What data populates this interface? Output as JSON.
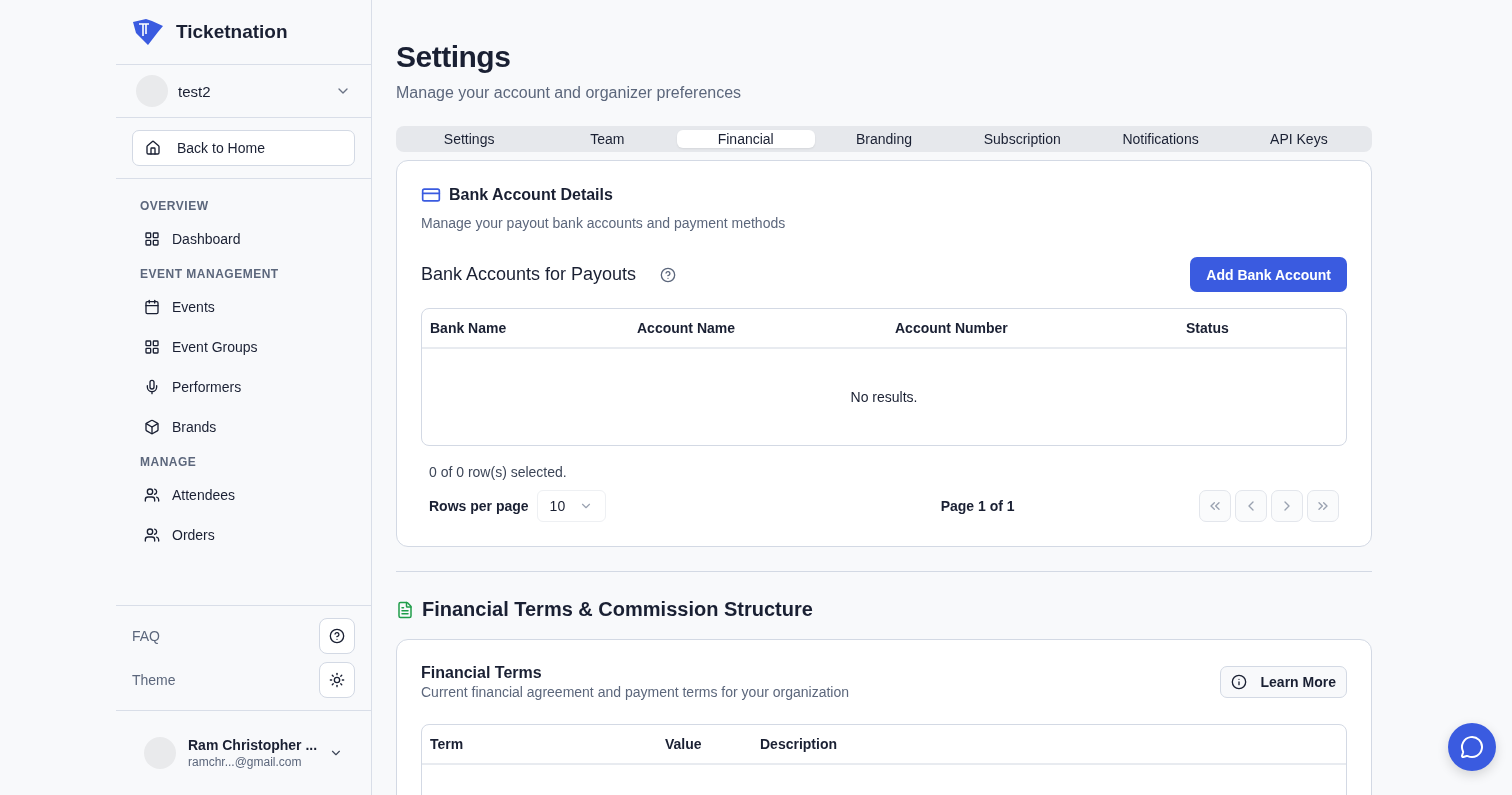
{
  "brand": {
    "name": "Ticketnation"
  },
  "org_switcher": {
    "name": "test2"
  },
  "back_button": "Back to Home",
  "nav_sections": [
    {
      "title": "OVERVIEW",
      "items": [
        {
          "label": "Dashboard"
        }
      ]
    },
    {
      "title": "EVENT MANAGEMENT",
      "items": [
        {
          "label": "Events"
        },
        {
          "label": "Event Groups"
        },
        {
          "label": "Performers"
        },
        {
          "label": "Brands"
        }
      ]
    },
    {
      "title": "MANAGE",
      "items": [
        {
          "label": "Attendees"
        },
        {
          "label": "Orders"
        }
      ]
    }
  ],
  "footer_links": [
    {
      "label": "FAQ"
    },
    {
      "label": "Theme"
    }
  ],
  "user": {
    "name": "Ram Christopher ...",
    "email": "ramchr...@gmail.com"
  },
  "page": {
    "title": "Settings",
    "subtitle": "Manage your account and organizer preferences"
  },
  "tabs": [
    {
      "label": "Settings",
      "selected": false
    },
    {
      "label": "Team",
      "selected": false
    },
    {
      "label": "Financial",
      "selected": true
    },
    {
      "label": "Branding",
      "selected": false
    },
    {
      "label": "Subscription",
      "selected": false
    },
    {
      "label": "Notifications",
      "selected": false
    },
    {
      "label": "API Keys",
      "selected": false
    }
  ],
  "bank_card": {
    "title": "Bank Account Details",
    "description": "Manage your payout bank accounts and payment methods",
    "section_title": "Bank Accounts for Payouts",
    "add_button": "Add Bank Account",
    "table": {
      "columns": [
        "Bank Name",
        "Account Name",
        "Account Number",
        "Status"
      ],
      "empty_text": "No results."
    },
    "selection_text": "0 of 0 row(s) selected.",
    "rows_per_page_label": "Rows per page",
    "rows_per_page": "10",
    "page_text": "Page 1 of 1"
  },
  "terms_section": {
    "title": "Financial Terms & Commission Structure",
    "card_title": "Financial Terms",
    "card_description": "Current financial agreement and payment terms for your organization",
    "learn_more": "Learn More",
    "table": {
      "columns": [
        "Term",
        "Value",
        "Description"
      ]
    }
  }
}
